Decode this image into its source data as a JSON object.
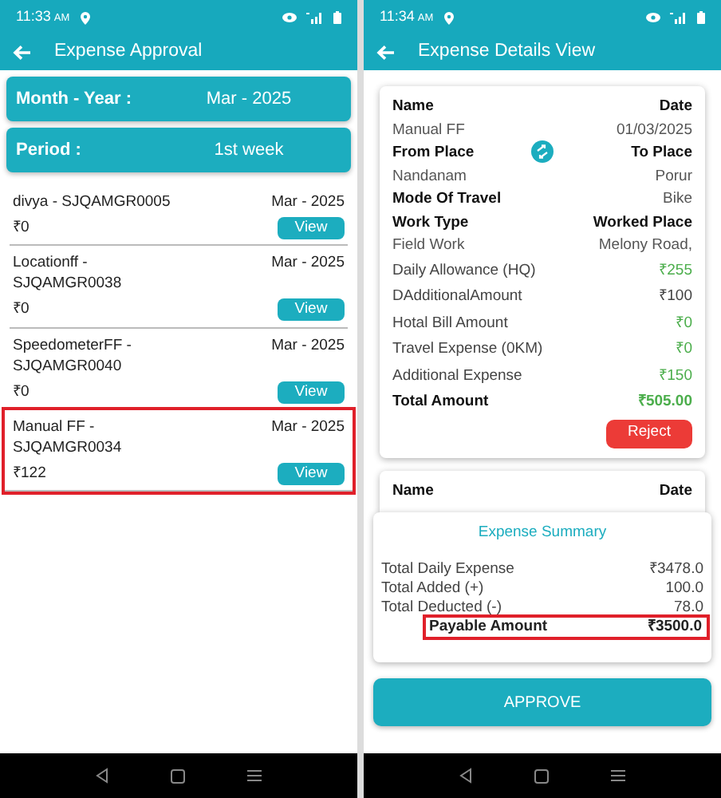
{
  "left_screen": {
    "status_bar": {
      "time": "11:33",
      "ampm": "AM"
    },
    "title": "Expense Approval",
    "filters": [
      {
        "label": "Month - Year :",
        "value": "Mar - 2025"
      },
      {
        "label": "Period :",
        "value": "1st week"
      }
    ],
    "entries": [
      {
        "name": "divya - SJQAMGR0005",
        "period": "Mar - 2025",
        "amount": "₹0",
        "button": "View",
        "highlighted": false
      },
      {
        "name": "Locationff - SJQAMGR0038",
        "period": "Mar - 2025",
        "amount": "₹0",
        "button": "View",
        "highlighted": false
      },
      {
        "name": "SpeedometerFF - SJQAMGR0040",
        "period": "Mar - 2025",
        "amount": "₹0",
        "button": "View",
        "highlighted": false
      },
      {
        "name": "Manual FF - SJQAMGR0034",
        "period": "Mar - 2025",
        "amount": "₹122",
        "button": "View",
        "highlighted": true
      }
    ]
  },
  "right_screen": {
    "status_bar": {
      "time": "11:34",
      "ampm": "AM"
    },
    "title": "Expense Details View",
    "details": [
      {
        "kind": "pair",
        "left_label": "Name",
        "left_value": "Manual FF",
        "right_label": "Date",
        "right_value": "01/03/2025",
        "swap_icon": false
      },
      {
        "kind": "pair",
        "left_label": "From Place",
        "left_value": "Nandanam",
        "right_label": "To Place",
        "right_value": "Porur",
        "swap_icon": true
      },
      {
        "kind": "inline",
        "left_label": "Mode Of Travel",
        "right_value": "Bike"
      },
      {
        "kind": "pair",
        "left_label": "Work Type",
        "left_value": "Field Work",
        "right_label": "Worked Place",
        "right_value": "Melony Road,",
        "swap_icon": false
      }
    ],
    "amounts": [
      {
        "label": "Daily Allowance (HQ)",
        "value": "₹255",
        "green": true,
        "bold": false
      },
      {
        "label": "DAdditionalAmount",
        "value": "₹100",
        "green": false,
        "bold": false
      },
      {
        "label": "Hotal Bill Amount",
        "value": "₹0",
        "green": true,
        "bold": false
      },
      {
        "label": "Travel Expense (0KM)",
        "value": "₹0",
        "green": true,
        "bold": false
      },
      {
        "label": "Additional Expense",
        "value": "₹150",
        "green": true,
        "bold": false
      },
      {
        "label": "Total Amount",
        "value": "₹505.00",
        "green": true,
        "bold": true
      }
    ],
    "reject_button": "Reject",
    "next_card": {
      "left_label": "Name",
      "right_label": "Date"
    },
    "summary": {
      "title": "Expense Summary",
      "rows": [
        {
          "label": "Total Daily Expense",
          "value": "₹3478.0",
          "highlighted": false
        },
        {
          "label": "Total Added (+)",
          "value": "100.0",
          "highlighted": false
        },
        {
          "label": "Total Deducted (-)",
          "value": "78.0",
          "highlighted": false
        },
        {
          "label": "Payable Amount",
          "value": "₹3500.0",
          "highlighted": true
        }
      ]
    },
    "approve_button": "APPROVE"
  }
}
